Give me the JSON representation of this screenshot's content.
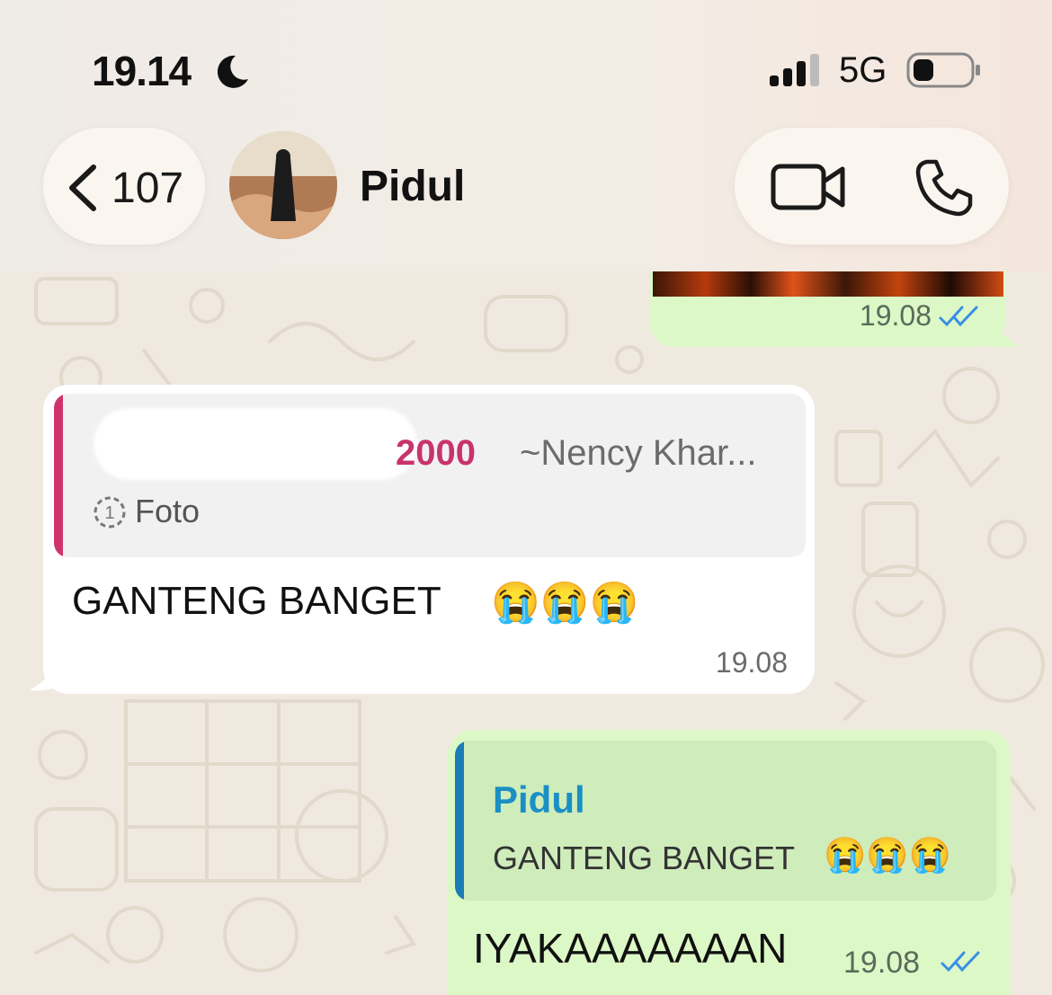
{
  "status_bar": {
    "time": "19.14",
    "network": "5G"
  },
  "header": {
    "back_count": "107",
    "contact_name": "Pidul"
  },
  "messages": {
    "out_top": {
      "time": "19.08"
    },
    "incoming": {
      "quote_number": "2000",
      "quote_author": "~Nency Khar...",
      "quote_media": "Foto",
      "text": "GANTENG BANGET",
      "emojis": "😭😭😭",
      "time": "19.08"
    },
    "outgoing": {
      "quote_name": "Pidul",
      "quote_text": "GANTENG BANGET",
      "quote_emojis": "😭😭😭",
      "text": "IYAKAAAAAAAN",
      "time": "19.08"
    }
  }
}
